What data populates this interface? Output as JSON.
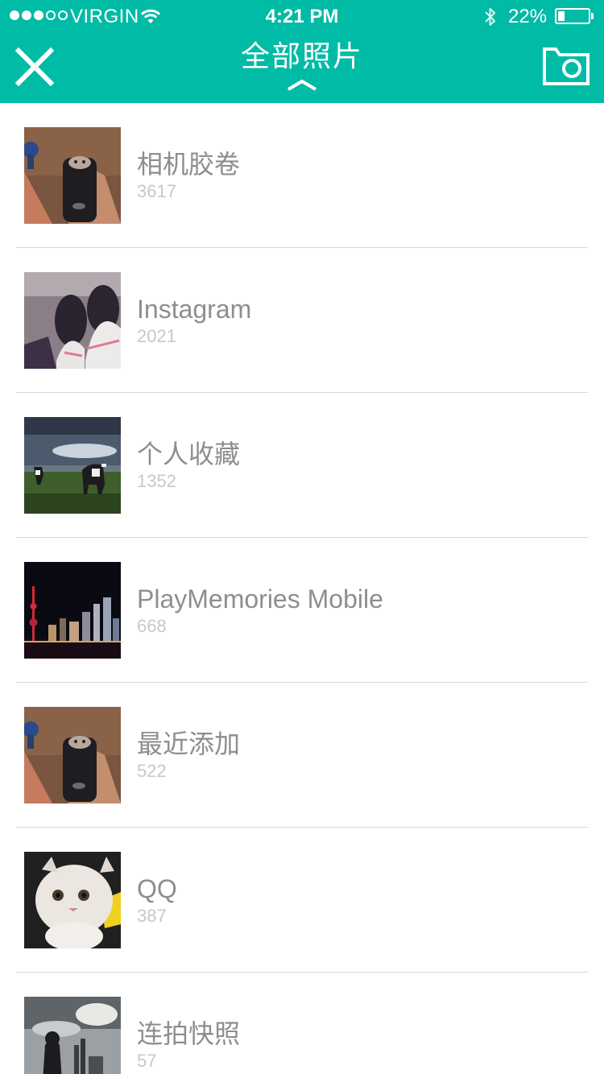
{
  "status_bar": {
    "carrier": "VIRGIN",
    "time": "4:21 PM",
    "battery_percent": "22%",
    "battery_level": 0.22,
    "signal_bars_filled": 3,
    "signal_bars_total": 5
  },
  "nav": {
    "title": "全部照片",
    "left_icon": "close-icon",
    "right_icon": "camera-icon",
    "title_indicator_icon": "chevron-up-icon"
  },
  "colors": {
    "accent": "#00bba5",
    "album_name": "#8e8e8e",
    "album_count": "#c8c8c8",
    "divider": "#d8d8d8"
  },
  "albums": [
    {
      "name": "相机胶卷",
      "count": "3617"
    },
    {
      "name": "Instagram",
      "count": "2021"
    },
    {
      "name": "个人收藏",
      "count": "1352"
    },
    {
      "name": "PlayMemories Mobile",
      "count": "668"
    },
    {
      "name": "最近添加",
      "count": "522"
    },
    {
      "name": "QQ",
      "count": "387"
    },
    {
      "name": "连拍快照",
      "count": "57"
    }
  ]
}
